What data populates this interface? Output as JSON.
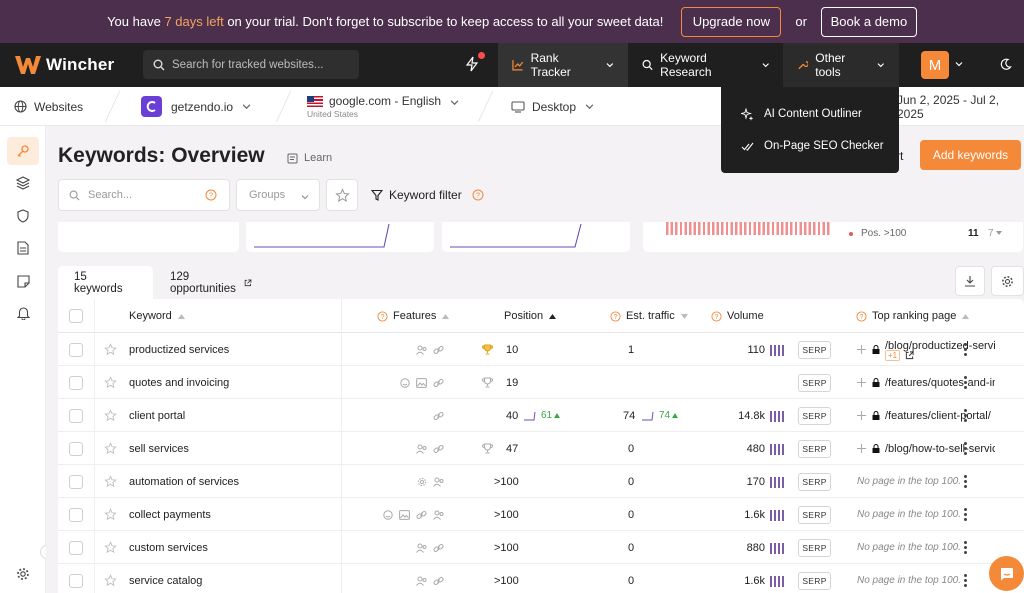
{
  "banner": {
    "msg_pre": "You have ",
    "msg_highlight": "7 days left",
    "msg_post": " on your trial. Don't forget to subscribe to keep access to all your sweet data!",
    "upgrade_label": "Upgrade now",
    "or_label": "or",
    "demo_label": "Book a demo"
  },
  "nav": {
    "brand": "Wincher",
    "search_placeholder": "Search for tracked websites...",
    "rank_tracker": "Rank Tracker",
    "keyword_research": "Keyword Research",
    "other_tools": "Other tools",
    "avatar_initial": "M"
  },
  "dropdown": {
    "items": [
      "AI Content Outliner",
      "On-Page SEO Checker"
    ]
  },
  "crumbs": {
    "websites": "Websites",
    "site": "getzendo.io",
    "engine": "google.com - English",
    "country": "United States",
    "device": "Desktop",
    "date_range": "Jun 2, 2025 - Jul 2, 2025"
  },
  "page": {
    "title": "Keywords: Overview",
    "learn": "Learn",
    "export_label": "rt",
    "add_keywords": "Add keywords",
    "search_placeholder": "Search...",
    "groups_placeholder": "Groups",
    "keyword_filter": "Keyword filter"
  },
  "summary": {
    "pos_label": "Pos. >100",
    "pos_count": "11",
    "pos_change": "7"
  },
  "tabs": {
    "keywords": "15 keywords",
    "opportunities": "129 opportunities"
  },
  "table": {
    "headers": {
      "keyword": "Keyword",
      "features": "Features",
      "position": "Position",
      "traffic": "Est. traffic",
      "volume": "Volume",
      "top_page": "Top ranking page"
    },
    "serp_label": "SERP",
    "no_page": "No page in the top 100.",
    "rows": [
      {
        "keyword": "productized services",
        "position": "10",
        "pos_change": "",
        "traffic": "1",
        "traffic_change": "",
        "volume": "110",
        "page": "/blog/productized-servic",
        "extra": "+1"
      },
      {
        "keyword": "quotes and invoicing",
        "position": "19",
        "pos_change": "",
        "traffic": "",
        "traffic_change": "",
        "volume": "",
        "page": "/features/quotes-and-inv",
        "extra": ""
      },
      {
        "keyword": "client portal",
        "position": "40",
        "pos_change": "61",
        "traffic": "74",
        "traffic_change": "74",
        "volume": "14.8k",
        "page": "/features/client-portal/",
        "extra": ""
      },
      {
        "keyword": "sell services",
        "position": "47",
        "pos_change": "",
        "traffic": "0",
        "traffic_change": "",
        "volume": "480",
        "page": "/blog/how-to-sell-service",
        "extra": ""
      },
      {
        "keyword": "automation of services",
        "position": ">100",
        "pos_change": "",
        "traffic": "0",
        "traffic_change": "",
        "volume": "170",
        "page": "",
        "extra": ""
      },
      {
        "keyword": "collect payments",
        "position": ">100",
        "pos_change": "",
        "traffic": "0",
        "traffic_change": "",
        "volume": "1.6k",
        "page": "",
        "extra": ""
      },
      {
        "keyword": "custom services",
        "position": ">100",
        "pos_change": "",
        "traffic": "0",
        "traffic_change": "",
        "volume": "880",
        "page": "",
        "extra": ""
      },
      {
        "keyword": "service catalog",
        "position": ">100",
        "pos_change": "",
        "traffic": "0",
        "traffic_change": "",
        "volume": "1.6k",
        "page": "",
        "extra": ""
      }
    ]
  },
  "colors": {
    "accent": "#f5893a",
    "banner_bg": "#4b2f4d",
    "nav_bg": "#1f1f1f",
    "volume_bars": "#7a5ca8",
    "positive": "#3aa64a"
  }
}
